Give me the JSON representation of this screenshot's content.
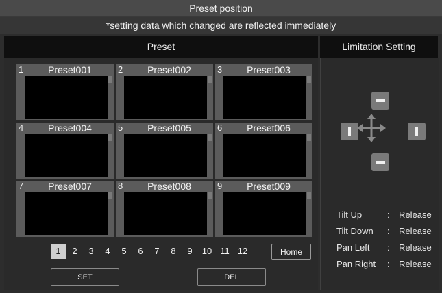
{
  "title": "Preset position",
  "notice": "*setting data which changed are reflected immediately",
  "sections": {
    "preset": "Preset",
    "limitation": "Limitation Setting"
  },
  "presets": [
    {
      "num": "1",
      "name": "Preset001"
    },
    {
      "num": "2",
      "name": "Preset002"
    },
    {
      "num": "3",
      "name": "Preset003"
    },
    {
      "num": "4",
      "name": "Preset004"
    },
    {
      "num": "5",
      "name": "Preset005"
    },
    {
      "num": "6",
      "name": "Preset006"
    },
    {
      "num": "7",
      "name": "Preset007"
    },
    {
      "num": "8",
      "name": "Preset008"
    },
    {
      "num": "9",
      "name": "Preset009"
    }
  ],
  "pages": [
    "1",
    "2",
    "3",
    "4",
    "5",
    "6",
    "7",
    "8",
    "9",
    "10",
    "11",
    "12"
  ],
  "active_page": "1",
  "home_label": "Home",
  "set_label": "SET",
  "del_label": "DEL",
  "limits": [
    {
      "label": "Tilt Up",
      "sep": ":",
      "value": "Release"
    },
    {
      "label": "Tilt Down",
      "sep": ":",
      "value": "Release"
    },
    {
      "label": "Pan Left",
      "sep": ":",
      "value": "Release"
    },
    {
      "label": "Pan Right",
      "sep": ":",
      "value": "Release"
    }
  ],
  "icons": {
    "up": "minus-icon",
    "down": "minus-icon",
    "left": "bar-icon",
    "right": "bar-icon",
    "center": "move-arrows-icon"
  }
}
